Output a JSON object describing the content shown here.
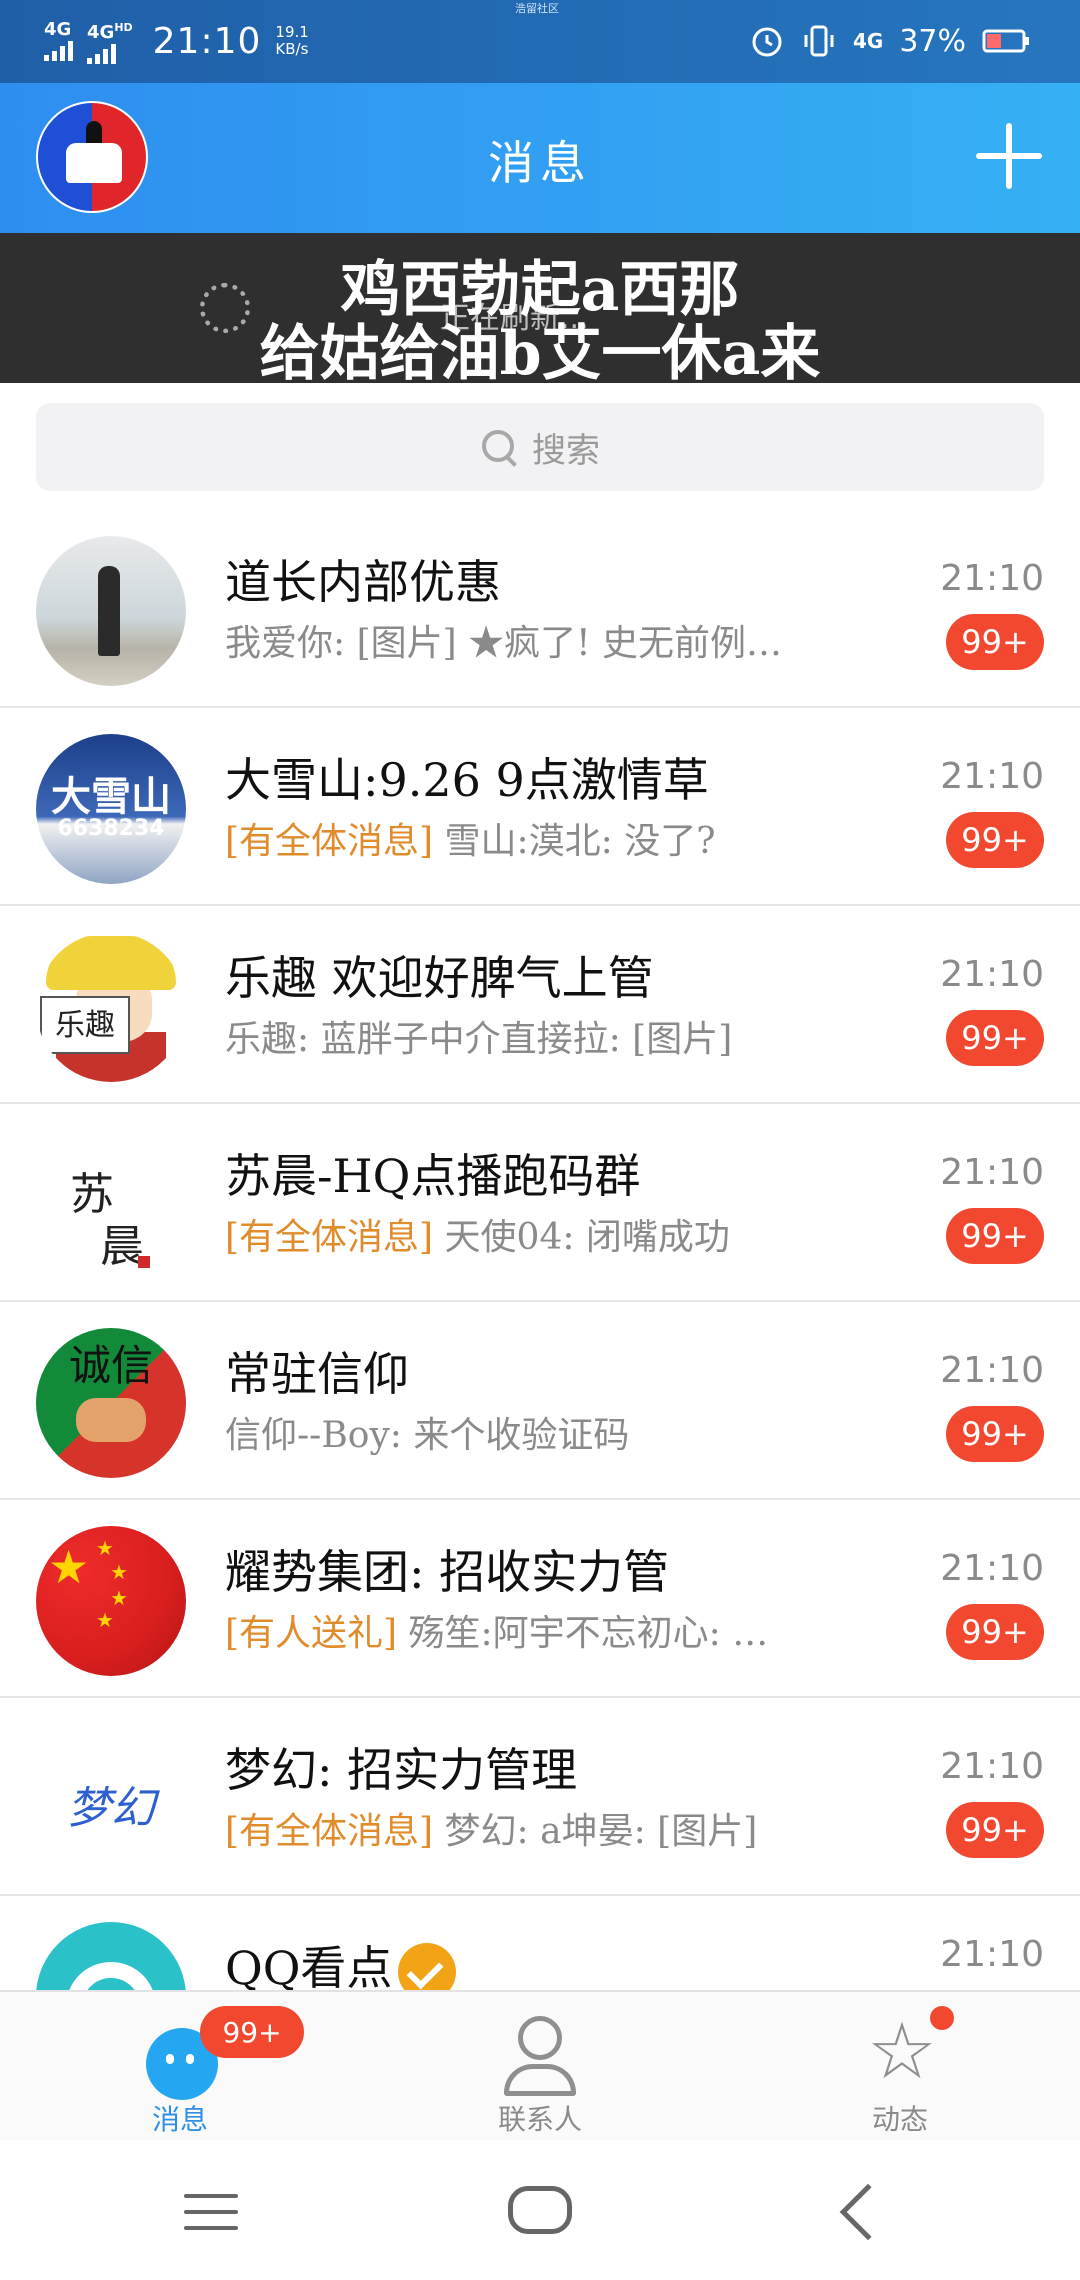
{
  "status_bar": {
    "network_1": "4G",
    "network_2": "4G",
    "network_2_sup": "HD",
    "time": "21:10",
    "speed_value": "19.1",
    "speed_unit": "KB/s",
    "carrier_tag": "浩留社区",
    "network_3": "4G",
    "battery": "37%",
    "icons": [
      "alarm-icon",
      "vibrate-icon",
      "signal-icon",
      "battery-icon"
    ]
  },
  "header": {
    "title": "消息",
    "add_icon": "plus-icon"
  },
  "refresh": {
    "overlay_line_1": "鸡西勃起a西那",
    "overlay_line_2": "给姑给油b艾一休a来",
    "status_text": "正在刷新..."
  },
  "search": {
    "placeholder": "搜索",
    "icon": "search-icon"
  },
  "chats": [
    {
      "name": "道长内部优惠",
      "tag": "",
      "preview": "我爱你: [图片] ★疯了! 史无前例…",
      "time": "21:10",
      "badge": "99+"
    },
    {
      "name": "大雪山:9.26 9点激情草",
      "tag": "[有全体消息]",
      "preview": " 雪山:漠北: 没了?",
      "time": "21:10",
      "badge": "99+",
      "avatar_text_1": "大雪山",
      "avatar_text_2": "6638234"
    },
    {
      "name": "乐趣 欢迎好脾气上管",
      "tag": "",
      "preview": "乐趣: 蓝胖子中介直接拉: [图片]",
      "time": "21:10",
      "badge": "99+",
      "avatar_text_1": "乐趣"
    },
    {
      "name": "苏晨-HQ点播跑码群",
      "tag": "[有全体消息]",
      "preview": " 天使04: 闭嘴成功",
      "time": "21:10",
      "badge": "99+",
      "avatar_text_1": "苏",
      "avatar_text_2": "晨"
    },
    {
      "name": "常驻信仰",
      "tag": "",
      "preview": "信仰--Boy: 来个收验证码",
      "time": "21:10",
      "badge": "99+",
      "avatar_text_1": "诚信"
    },
    {
      "name": "耀势集团: 招收实力管",
      "tag": "[有人送礼]",
      "preview": " 殇笙:阿宇不忘初心: …",
      "time": "21:10",
      "badge": "99+"
    },
    {
      "name": "梦幻: 招实力管理",
      "tag": "[有全体消息]",
      "preview": " 梦幻: a坤晏: [图片]",
      "time": "21:10",
      "badge": "99+",
      "avatar_text_1": "梦幻"
    },
    {
      "name": "QQ看点",
      "tag": "",
      "preview": "",
      "time": "21:10",
      "badge": ""
    }
  ],
  "bottom_nav": {
    "messages_label": "消息",
    "messages_badge": "99+",
    "contacts_label": "联系人",
    "feeds_label": "动态"
  },
  "colors": {
    "header_blue": "#2e8ef0",
    "badge_red": "#f2482f",
    "tag_orange": "#e08b2c",
    "active_blue": "#2f8fe6"
  }
}
